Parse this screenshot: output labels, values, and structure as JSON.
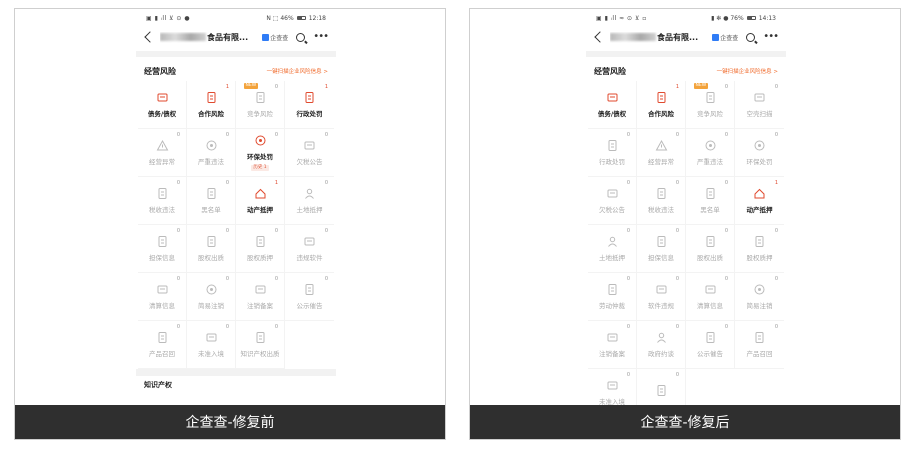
{
  "panels": [
    {
      "status": {
        "left": "▣ ▮ ᵢll ⊻ ⊙ ●",
        "right": "N ⬚ 46%",
        "time": "12:18"
      },
      "title_suffix": "食品有限...",
      "qcc_label": "企查查",
      "section_title": "经营风险",
      "section_link": "一键扫描企业风险信息 >",
      "items": [
        {
          "label": "债务/债权",
          "count": "",
          "active": true,
          "icon": "debt-icon"
        },
        {
          "label": "合作风险",
          "count": "1",
          "active": true,
          "icon": "cooperation-risk-icon"
        },
        {
          "label": "竞争风险",
          "count": "0",
          "active": false,
          "icon": "competition-risk-icon",
          "new": "NEW"
        },
        {
          "label": "行政处罚",
          "count": "1",
          "active": true,
          "icon": "admin-penalty-icon"
        },
        {
          "label": "经营异常",
          "count": "0",
          "active": false,
          "icon": "warning-icon"
        },
        {
          "label": "严重违法",
          "count": "0",
          "active": false,
          "icon": "serious-violation-icon"
        },
        {
          "label": "环保处罚",
          "count": "0",
          "active": true,
          "icon": "env-penalty-icon",
          "subtag": "历史 1"
        },
        {
          "label": "欠税公告",
          "count": "0",
          "active": false,
          "icon": "tax-arrears-icon"
        },
        {
          "label": "税收违法",
          "count": "0",
          "active": false,
          "icon": "tax-violation-icon"
        },
        {
          "label": "黑名单",
          "count": "0",
          "active": false,
          "icon": "blacklist-icon"
        },
        {
          "label": "动产抵押",
          "count": "1",
          "active": true,
          "icon": "chattel-mortgage-icon"
        },
        {
          "label": "土地抵押",
          "count": "0",
          "active": false,
          "icon": "land-mortgage-icon"
        },
        {
          "label": "担保信息",
          "count": "0",
          "active": false,
          "icon": "guarantee-icon"
        },
        {
          "label": "股权出质",
          "count": "0",
          "active": false,
          "icon": "equity-pledge-icon"
        },
        {
          "label": "股权质押",
          "count": "0",
          "active": false,
          "icon": "equity-mortgage-icon"
        },
        {
          "label": "违规软件",
          "count": "0",
          "active": false,
          "icon": "illegal-software-icon"
        },
        {
          "label": "清算信息",
          "count": "0",
          "active": false,
          "icon": "liquidation-icon"
        },
        {
          "label": "简易注销",
          "count": "0",
          "active": false,
          "icon": "simple-cancel-icon"
        },
        {
          "label": "注销备案",
          "count": "0",
          "active": false,
          "icon": "cancel-filing-icon"
        },
        {
          "label": "公示催告",
          "count": "0",
          "active": false,
          "icon": "public-notice-icon"
        },
        {
          "label": "产品召回",
          "count": "0",
          "active": false,
          "icon": "product-recall-icon"
        },
        {
          "label": "未准入境",
          "count": "0",
          "active": false,
          "icon": "entry-denied-icon"
        },
        {
          "label": "知识产权出质",
          "count": "0",
          "active": false,
          "icon": "ip-pledge-icon"
        }
      ],
      "next_section": "知识产权",
      "caption": "企查查-修复前"
    },
    {
      "status": {
        "left": "▣ ▮ ᵢll ≈ ⊙ ⊻ ▫",
        "right": "▮ ✻ ● 76%",
        "time": "14:13"
      },
      "title_suffix": "食品有限...",
      "qcc_label": "企查查",
      "section_title": "经营风险",
      "section_link": "一键扫描企业风险信息 >",
      "items": [
        {
          "label": "债务/债权",
          "count": "",
          "active": true,
          "icon": "debt-icon"
        },
        {
          "label": "合作风险",
          "count": "1",
          "active": true,
          "icon": "cooperation-risk-icon"
        },
        {
          "label": "竞争风险",
          "count": "0",
          "active": false,
          "icon": "competition-risk-icon",
          "new": "NEW"
        },
        {
          "label": "空壳扫描",
          "count": "0",
          "active": false,
          "icon": "shell-scan-icon"
        },
        {
          "label": "行政处罚",
          "count": "0",
          "active": false,
          "icon": "admin-penalty-icon"
        },
        {
          "label": "经营异常",
          "count": "0",
          "active": false,
          "icon": "warning-icon"
        },
        {
          "label": "严重违法",
          "count": "0",
          "active": false,
          "icon": "serious-violation-icon"
        },
        {
          "label": "环保处罚",
          "count": "0",
          "active": false,
          "icon": "env-penalty-icon"
        },
        {
          "label": "欠税公告",
          "count": "0",
          "active": false,
          "icon": "tax-arrears-icon"
        },
        {
          "label": "税收违法",
          "count": "0",
          "active": false,
          "icon": "tax-violation-icon"
        },
        {
          "label": "黑名单",
          "count": "0",
          "active": false,
          "icon": "blacklist-icon"
        },
        {
          "label": "动产抵押",
          "count": "1",
          "active": true,
          "icon": "chattel-mortgage-icon"
        },
        {
          "label": "土地抵押",
          "count": "0",
          "active": false,
          "icon": "land-mortgage-icon"
        },
        {
          "label": "担保信息",
          "count": "0",
          "active": false,
          "icon": "guarantee-icon"
        },
        {
          "label": "股权出质",
          "count": "0",
          "active": false,
          "icon": "equity-pledge-icon"
        },
        {
          "label": "股权质押",
          "count": "0",
          "active": false,
          "icon": "equity-mortgage-icon"
        },
        {
          "label": "劳动仲裁",
          "count": "0",
          "active": false,
          "icon": "labor-arbitration-icon"
        },
        {
          "label": "软件违规",
          "count": "0",
          "active": false,
          "icon": "illegal-software-icon"
        },
        {
          "label": "清算信息",
          "count": "0",
          "active": false,
          "icon": "liquidation-icon"
        },
        {
          "label": "简易注销",
          "count": "0",
          "active": false,
          "icon": "simple-cancel-icon"
        },
        {
          "label": "注销备案",
          "count": "0",
          "active": false,
          "icon": "cancel-filing-icon"
        },
        {
          "label": "政府约谈",
          "count": "0",
          "active": false,
          "icon": "gov-interview-icon"
        },
        {
          "label": "公示催告",
          "count": "0",
          "active": false,
          "icon": "public-notice-icon"
        },
        {
          "label": "产品召回",
          "count": "0",
          "active": false,
          "icon": "product-recall-icon"
        },
        {
          "label": "未准入境",
          "count": "0",
          "active": false,
          "icon": "entry-denied-icon"
        },
        {
          "label": "",
          "count": "0",
          "active": false,
          "icon": "ip-pledge-icon"
        }
      ],
      "next_section": "",
      "caption": "企查查-修复后"
    }
  ],
  "colors": {
    "accent": "#f06a2b",
    "active_icon": "#e04a2e",
    "inactive": "#bbbbbb",
    "caption_bg": "#2f2f2f"
  }
}
